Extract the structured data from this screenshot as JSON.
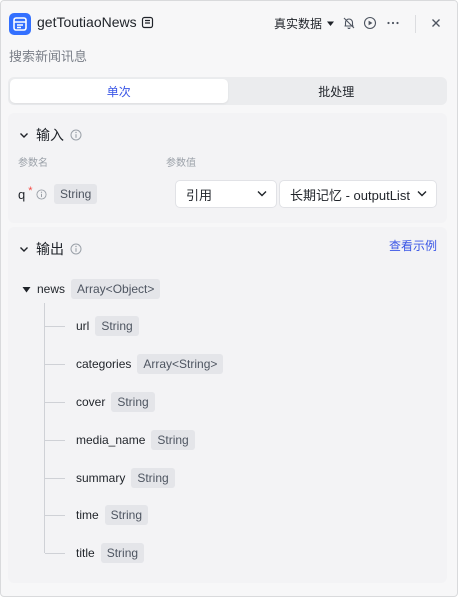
{
  "header": {
    "title": "getToutiaoNews",
    "subtitle": "搜索新闻讯息",
    "data_source": "真实数据",
    "icons": [
      "app-icon",
      "edit-icon",
      "bell-off-icon",
      "play-circle-icon",
      "more-icon",
      "close-icon"
    ]
  },
  "tabs": [
    {
      "label": "单次",
      "active": true
    },
    {
      "label": "批处理",
      "active": false
    }
  ],
  "input": {
    "title": "输入",
    "col_param_name": "参数名",
    "col_param_value": "参数值",
    "param": {
      "name": "q",
      "required_mark": "*",
      "type": "String",
      "ref_mode": "引用",
      "value": "长期记忆 - outputList"
    }
  },
  "output": {
    "title": "输出",
    "view_example": "查看示例",
    "root": {
      "name": "news",
      "type": "Array<Object>"
    },
    "children": [
      {
        "name": "url",
        "type": "String"
      },
      {
        "name": "categories",
        "type": "Array<String>"
      },
      {
        "name": "cover",
        "type": "String"
      },
      {
        "name": "media_name",
        "type": "String"
      },
      {
        "name": "summary",
        "type": "String"
      },
      {
        "name": "time",
        "type": "String"
      },
      {
        "name": "title",
        "type": "String"
      }
    ]
  },
  "colors": {
    "accent": "#3a56e6",
    "app_icon": "#3370ff",
    "required": "#f54a45"
  }
}
